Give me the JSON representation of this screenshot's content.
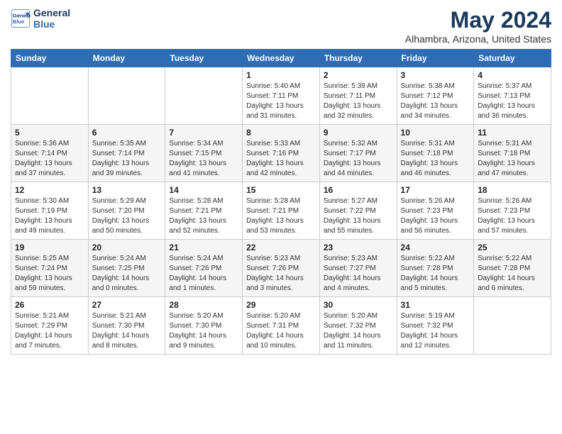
{
  "header": {
    "logo_line1": "General",
    "logo_line2": "Blue",
    "title": "May 2024",
    "subtitle": "Alhambra, Arizona, United States"
  },
  "weekdays": [
    "Sunday",
    "Monday",
    "Tuesday",
    "Wednesday",
    "Thursday",
    "Friday",
    "Saturday"
  ],
  "weeks": [
    [
      {
        "day": "",
        "info": ""
      },
      {
        "day": "",
        "info": ""
      },
      {
        "day": "",
        "info": ""
      },
      {
        "day": "1",
        "info": "Sunrise: 5:40 AM\nSunset: 7:11 PM\nDaylight: 13 hours\nand 31 minutes."
      },
      {
        "day": "2",
        "info": "Sunrise: 5:39 AM\nSunset: 7:11 PM\nDaylight: 13 hours\nand 32 minutes."
      },
      {
        "day": "3",
        "info": "Sunrise: 5:38 AM\nSunset: 7:12 PM\nDaylight: 13 hours\nand 34 minutes."
      },
      {
        "day": "4",
        "info": "Sunrise: 5:37 AM\nSunset: 7:13 PM\nDaylight: 13 hours\nand 36 minutes."
      }
    ],
    [
      {
        "day": "5",
        "info": "Sunrise: 5:36 AM\nSunset: 7:14 PM\nDaylight: 13 hours\nand 37 minutes."
      },
      {
        "day": "6",
        "info": "Sunrise: 5:35 AM\nSunset: 7:14 PM\nDaylight: 13 hours\nand 39 minutes."
      },
      {
        "day": "7",
        "info": "Sunrise: 5:34 AM\nSunset: 7:15 PM\nDaylight: 13 hours\nand 41 minutes."
      },
      {
        "day": "8",
        "info": "Sunrise: 5:33 AM\nSunset: 7:16 PM\nDaylight: 13 hours\nand 42 minutes."
      },
      {
        "day": "9",
        "info": "Sunrise: 5:32 AM\nSunset: 7:17 PM\nDaylight: 13 hours\nand 44 minutes."
      },
      {
        "day": "10",
        "info": "Sunrise: 5:31 AM\nSunset: 7:18 PM\nDaylight: 13 hours\nand 46 minutes."
      },
      {
        "day": "11",
        "info": "Sunrise: 5:31 AM\nSunset: 7:18 PM\nDaylight: 13 hours\nand 47 minutes."
      }
    ],
    [
      {
        "day": "12",
        "info": "Sunrise: 5:30 AM\nSunset: 7:19 PM\nDaylight: 13 hours\nand 49 minutes."
      },
      {
        "day": "13",
        "info": "Sunrise: 5:29 AM\nSunset: 7:20 PM\nDaylight: 13 hours\nand 50 minutes."
      },
      {
        "day": "14",
        "info": "Sunrise: 5:28 AM\nSunset: 7:21 PM\nDaylight: 13 hours\nand 52 minutes."
      },
      {
        "day": "15",
        "info": "Sunrise: 5:28 AM\nSunset: 7:21 PM\nDaylight: 13 hours\nand 53 minutes."
      },
      {
        "day": "16",
        "info": "Sunrise: 5:27 AM\nSunset: 7:22 PM\nDaylight: 13 hours\nand 55 minutes."
      },
      {
        "day": "17",
        "info": "Sunrise: 5:26 AM\nSunset: 7:23 PM\nDaylight: 13 hours\nand 56 minutes."
      },
      {
        "day": "18",
        "info": "Sunrise: 5:26 AM\nSunset: 7:23 PM\nDaylight: 13 hours\nand 57 minutes."
      }
    ],
    [
      {
        "day": "19",
        "info": "Sunrise: 5:25 AM\nSunset: 7:24 PM\nDaylight: 13 hours\nand 59 minutes."
      },
      {
        "day": "20",
        "info": "Sunrise: 5:24 AM\nSunset: 7:25 PM\nDaylight: 14 hours\nand 0 minutes."
      },
      {
        "day": "21",
        "info": "Sunrise: 5:24 AM\nSunset: 7:26 PM\nDaylight: 14 hours\nand 1 minutes."
      },
      {
        "day": "22",
        "info": "Sunrise: 5:23 AM\nSunset: 7:26 PM\nDaylight: 14 hours\nand 3 minutes."
      },
      {
        "day": "23",
        "info": "Sunrise: 5:23 AM\nSunset: 7:27 PM\nDaylight: 14 hours\nand 4 minutes."
      },
      {
        "day": "24",
        "info": "Sunrise: 5:22 AM\nSunset: 7:28 PM\nDaylight: 14 hours\nand 5 minutes."
      },
      {
        "day": "25",
        "info": "Sunrise: 5:22 AM\nSunset: 7:28 PM\nDaylight: 14 hours\nand 6 minutes."
      }
    ],
    [
      {
        "day": "26",
        "info": "Sunrise: 5:21 AM\nSunset: 7:29 PM\nDaylight: 14 hours\nand 7 minutes."
      },
      {
        "day": "27",
        "info": "Sunrise: 5:21 AM\nSunset: 7:30 PM\nDaylight: 14 hours\nand 8 minutes."
      },
      {
        "day": "28",
        "info": "Sunrise: 5:20 AM\nSunset: 7:30 PM\nDaylight: 14 hours\nand 9 minutes."
      },
      {
        "day": "29",
        "info": "Sunrise: 5:20 AM\nSunset: 7:31 PM\nDaylight: 14 hours\nand 10 minutes."
      },
      {
        "day": "30",
        "info": "Sunrise: 5:20 AM\nSunset: 7:32 PM\nDaylight: 14 hours\nand 11 minutes."
      },
      {
        "day": "31",
        "info": "Sunrise: 5:19 AM\nSunset: 7:32 PM\nDaylight: 14 hours\nand 12 minutes."
      },
      {
        "day": "",
        "info": ""
      }
    ]
  ]
}
